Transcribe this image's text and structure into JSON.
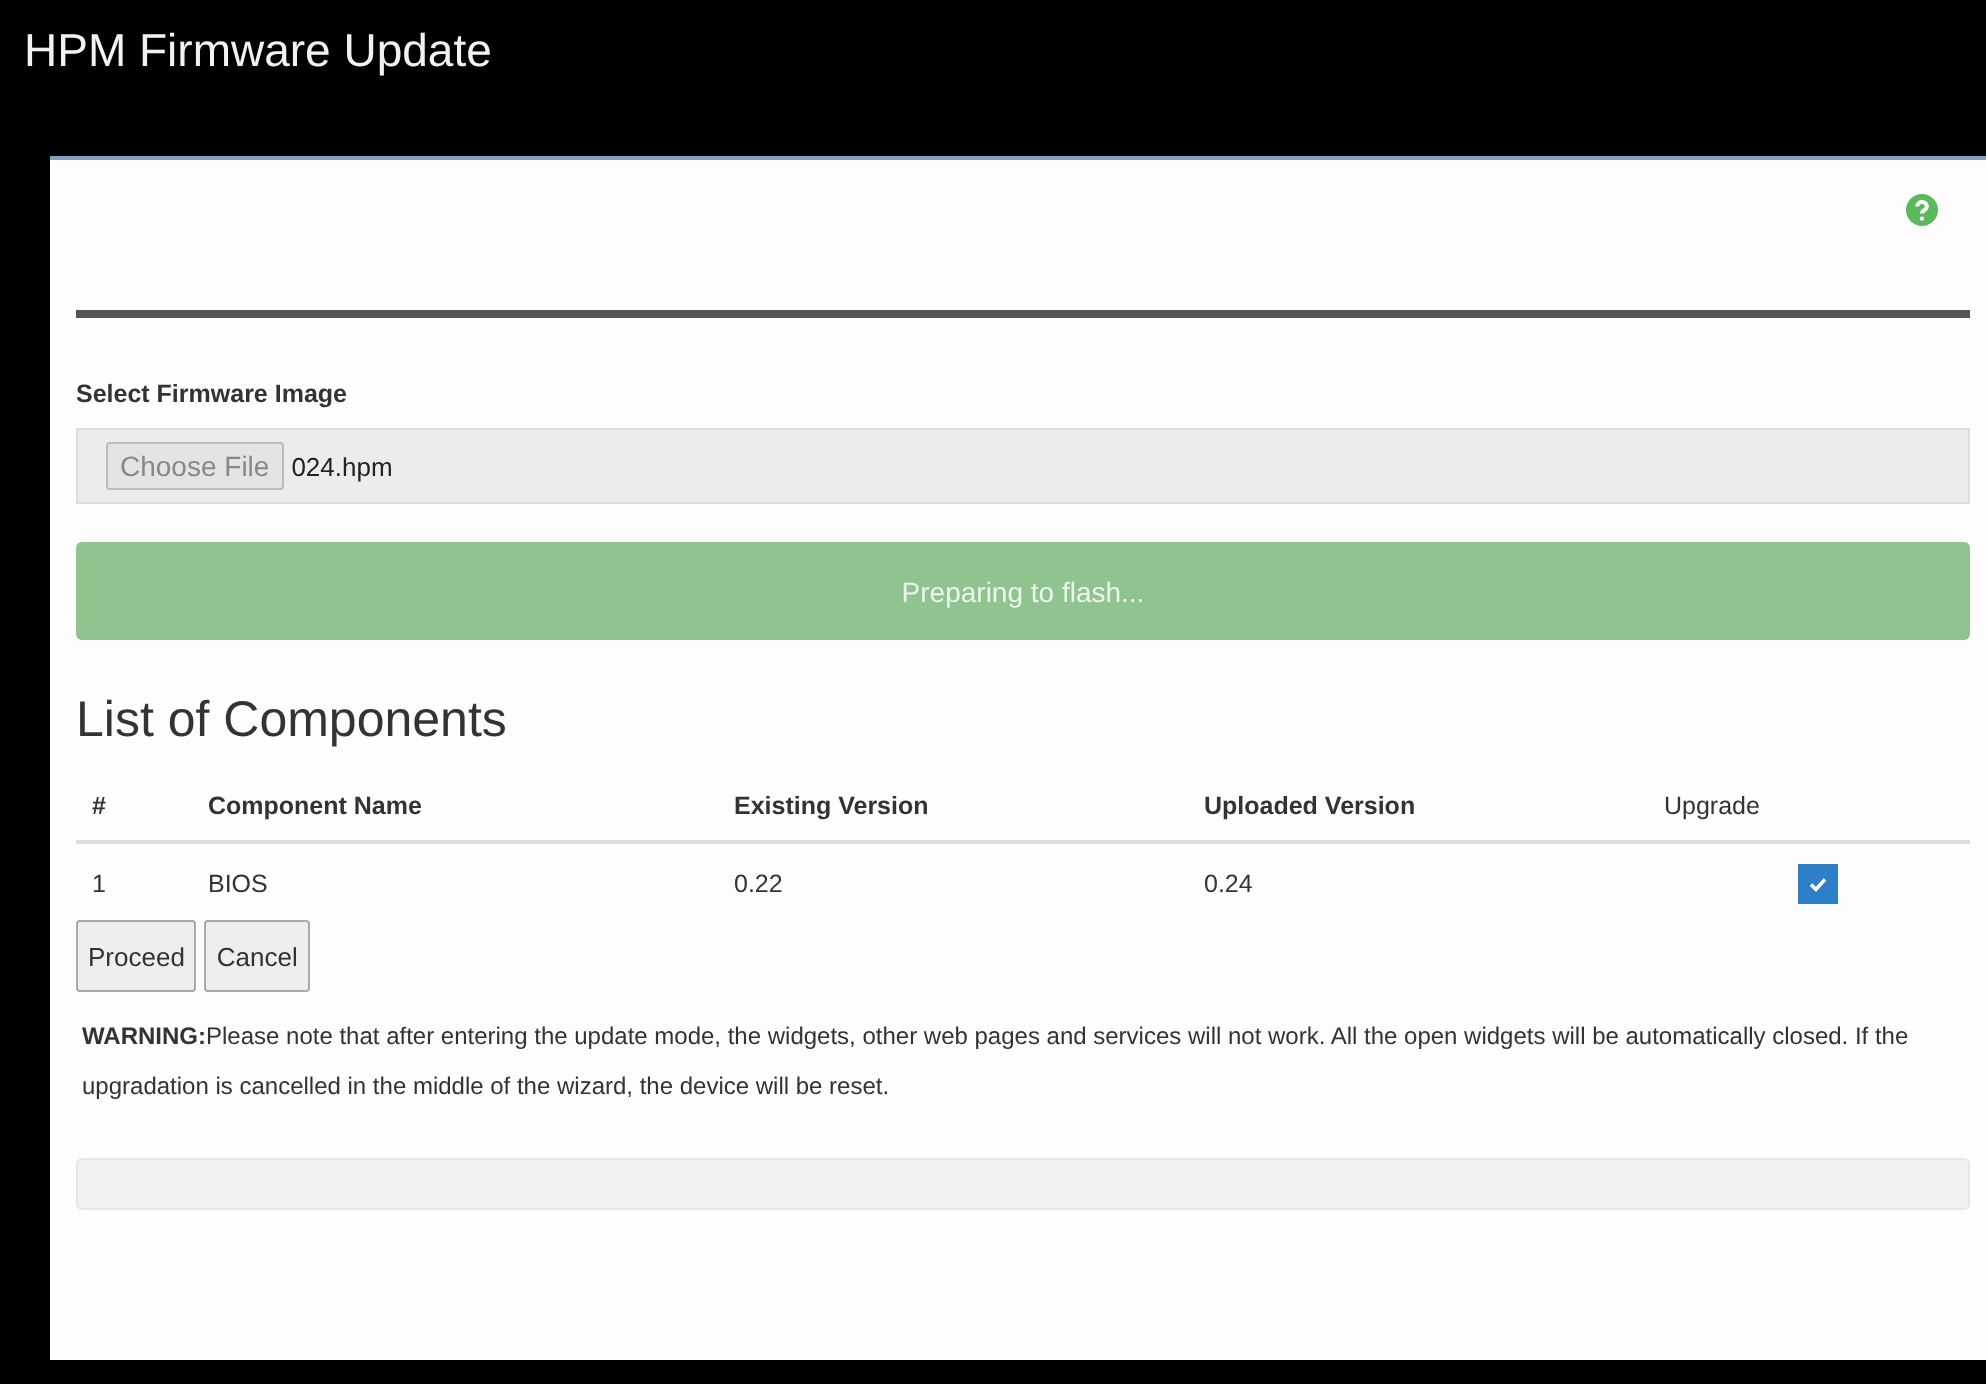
{
  "window": {
    "title": "HPM Firmware Update"
  },
  "file_select": {
    "label": "Select Firmware Image",
    "button": "Choose File",
    "value": "024.hpm"
  },
  "progress": {
    "text": "Preparing to flash...",
    "level": 1
  },
  "components": {
    "title": "List of Components",
    "columns": [
      "#",
      "Component Name",
      "Existing Version",
      "Uploaded Version",
      "Upgrade"
    ],
    "rows": [
      {
        "index": "1",
        "name": "BIOS",
        "existing": "0.22",
        "uploaded": "0.24",
        "checked": true
      }
    ]
  },
  "buttons": [
    "Proceed",
    "Cancel"
  ],
  "warning": "**WARNING:**Please note that after entering the update mode, the widgets, other web pages and services will not work. All the open widgets will be automatically closed. If the upgradation is cancelled in the middle of the wizard, the device will be reset."
}
